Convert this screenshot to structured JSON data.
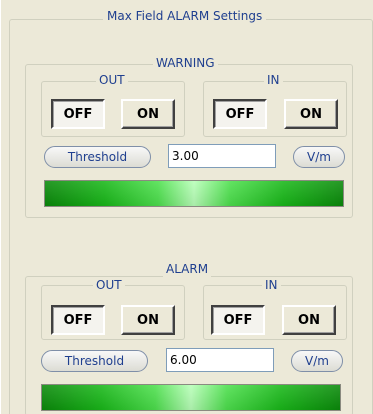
{
  "panel": {
    "title": "Max Field ALARM Settings"
  },
  "warning": {
    "title": "WARNING",
    "out": {
      "label": "OUT",
      "off_label": "OFF",
      "on_label": "ON",
      "state": "OFF"
    },
    "in": {
      "label": "IN",
      "off_label": "OFF",
      "on_label": "ON",
      "state": "OFF"
    },
    "threshold_label": "Threshold",
    "threshold_value": "3.00",
    "unit_label": "V/m",
    "indicator_color": "#19b819"
  },
  "alarm": {
    "title": "ALARM",
    "out": {
      "label": "OUT",
      "off_label": "OFF",
      "on_label": "ON",
      "state": "OFF"
    },
    "in": {
      "label": "IN",
      "off_label": "OFF",
      "on_label": "ON",
      "state": "OFF"
    },
    "threshold_label": "Threshold",
    "threshold_value": "6.00",
    "unit_label": "V/m",
    "indicator_color": "#19b819"
  }
}
